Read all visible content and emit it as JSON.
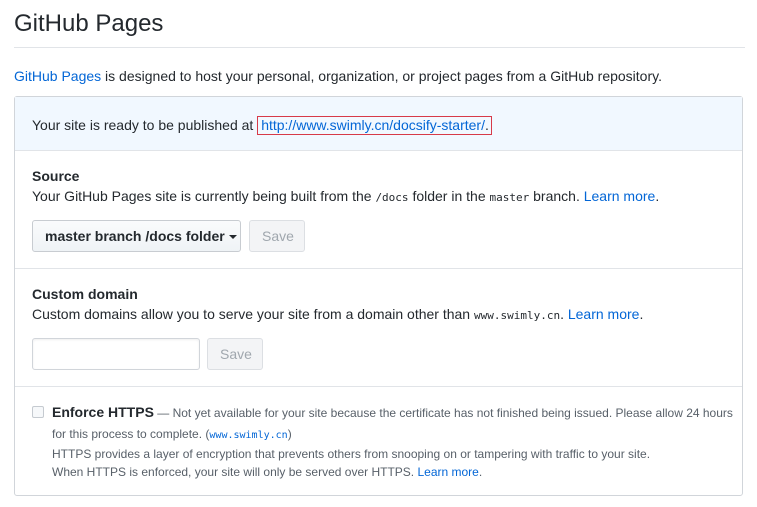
{
  "page": {
    "title": "GitHub Pages"
  },
  "intro": {
    "link": "GitHub Pages",
    "text": " is designed to host your personal, organization, or project pages from a GitHub repository."
  },
  "flash": {
    "text": "Your site is ready to be published at ",
    "url": "http://www.swimly.cn/docsify-starter/",
    "suffix": "."
  },
  "source": {
    "heading": "Source",
    "desc_prefix": "Your GitHub Pages site is currently being built from the ",
    "folder": "/docs",
    "desc_mid": " folder in the ",
    "branch": "master",
    "desc_suffix": " branch. ",
    "learn_more": "Learn more",
    "learn_more_suffix": ".",
    "select_label": "master branch /docs folder",
    "save_label": "Save"
  },
  "custom_domain": {
    "heading": "Custom domain",
    "desc_prefix": "Custom domains allow you to serve your site from a domain other than ",
    "domain": "www.swimly.cn",
    "desc_suffix": ". ",
    "learn_more": "Learn more",
    "learn_more_suffix": ".",
    "input_value": "",
    "save_label": "Save"
  },
  "https": {
    "title": "Enforce HTTPS",
    "dash": " — ",
    "note": "Not yet available for your site because the certificate has not finished being issued. Please allow 24 hours",
    "note2_prefix": "for this process to complete. (",
    "note2_domain": "www.swimly.cn",
    "note2_suffix": ")",
    "line3": "HTTPS provides a layer of encryption that prevents others from snooping on or tampering with traffic to your site.",
    "line4": "When HTTPS is enforced, your site will only be served over HTTPS. ",
    "learn_more": "Learn more",
    "learn_more_suffix": ".",
    "checked": false
  },
  "colors": {
    "link": "#0366d6",
    "flash_bg": "#f1f8ff",
    "highlight_border": "#d73a49"
  }
}
